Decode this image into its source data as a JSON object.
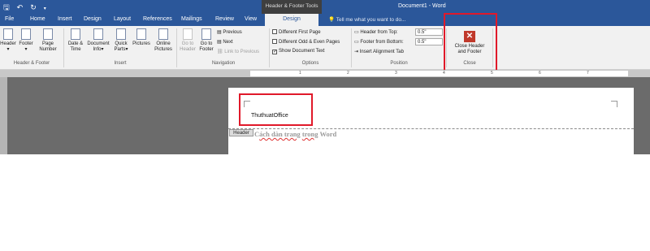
{
  "titlebar": {
    "save_icon": "save-icon",
    "undo_icon": "undo-icon",
    "redo_icon": "redo-icon",
    "customize_icon": "customize-icon",
    "context_group": "Header & Footer Tools",
    "document_title": "Document1 - Word"
  },
  "tabs": {
    "file": "File",
    "home": "Home",
    "insert": "Insert",
    "design": "Design",
    "layout": "Layout",
    "references": "References",
    "mailings": "Mailings",
    "review": "Review",
    "view": "View",
    "design_context": "Design"
  },
  "tell_me": "Tell me what you want to do...",
  "ribbon": {
    "header_footer": {
      "header": "Header",
      "footer": "Footer",
      "page_number_line1": "Page",
      "page_number_line2": "Number",
      "group_label": "Header & Footer"
    },
    "insert": {
      "date_time_line1": "Date &",
      "date_time_line2": "Time",
      "doc_info_line1": "Document",
      "doc_info_line2": "Info",
      "quick_parts_line1": "Quick",
      "quick_parts_line2": "Parts",
      "pictures": "Pictures",
      "online_pictures_line1": "Online",
      "online_pictures_line2": "Pictures",
      "group_label": "Insert"
    },
    "navigation": {
      "go_to_header_line1": "Go to",
      "go_to_header_line2": "Header",
      "go_to_footer_line1": "Go to",
      "go_to_footer_line2": "Footer",
      "previous": "Previous",
      "next": "Next",
      "link_to_previous": "Link to Previous",
      "group_label": "Navigation"
    },
    "options": {
      "different_first_page": "Different First Page",
      "different_odd_even": "Different Odd & Even Pages",
      "show_document_text": "Show Document Text",
      "show_document_text_checked": true,
      "group_label": "Options"
    },
    "position": {
      "header_from_top": "Header from Top:",
      "header_from_top_value": "0.5\"",
      "footer_from_bottom": "Footer from Bottom:",
      "footer_from_bottom_value": "0.5\"",
      "insert_alignment_tab": "Insert Alignment Tab",
      "group_label": "Position"
    },
    "close": {
      "close_line1": "Close Header",
      "close_line2": "and Footer",
      "group_label": "Close"
    }
  },
  "ruler": {
    "numbers": [
      "1",
      "2",
      "3",
      "4",
      "5",
      "6",
      "7"
    ]
  },
  "document": {
    "header_text": "ThuthuatOffice",
    "header_tag": "Header",
    "body_prefix": "C",
    "body_wavy1": "ách dàn trang",
    "body_space": " ",
    "body_wavy2": "trong",
    "body_suffix": " Word"
  },
  "colors": {
    "word_blue": "#2b579a",
    "ribbon_bg": "#f1f1f1",
    "highlight_red": "#e0192a",
    "close_icon": "#c0392b"
  }
}
